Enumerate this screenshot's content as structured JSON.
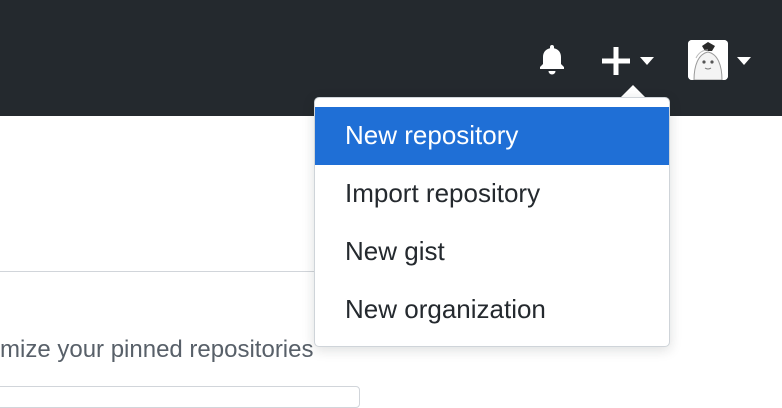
{
  "header": {
    "icons": {
      "notifications": "bell-icon",
      "create_new": "plus-icon",
      "create_caret": "chevron-down-icon",
      "avatar_caret": "chevron-down-icon"
    },
    "colors": {
      "header_bg": "#24292e",
      "icon": "#ffffff"
    }
  },
  "new_menu": {
    "items": [
      {
        "label": "New repository",
        "active": true
      },
      {
        "label": "Import repository",
        "active": false
      },
      {
        "label": "New gist",
        "active": false
      },
      {
        "label": "New organization",
        "active": false
      }
    ],
    "colors": {
      "active_bg": "#1f6fd6",
      "active_text": "#ffffff",
      "text": "#24292e"
    }
  },
  "background_page": {
    "pinned_hint": "mize your pinned repositories"
  }
}
